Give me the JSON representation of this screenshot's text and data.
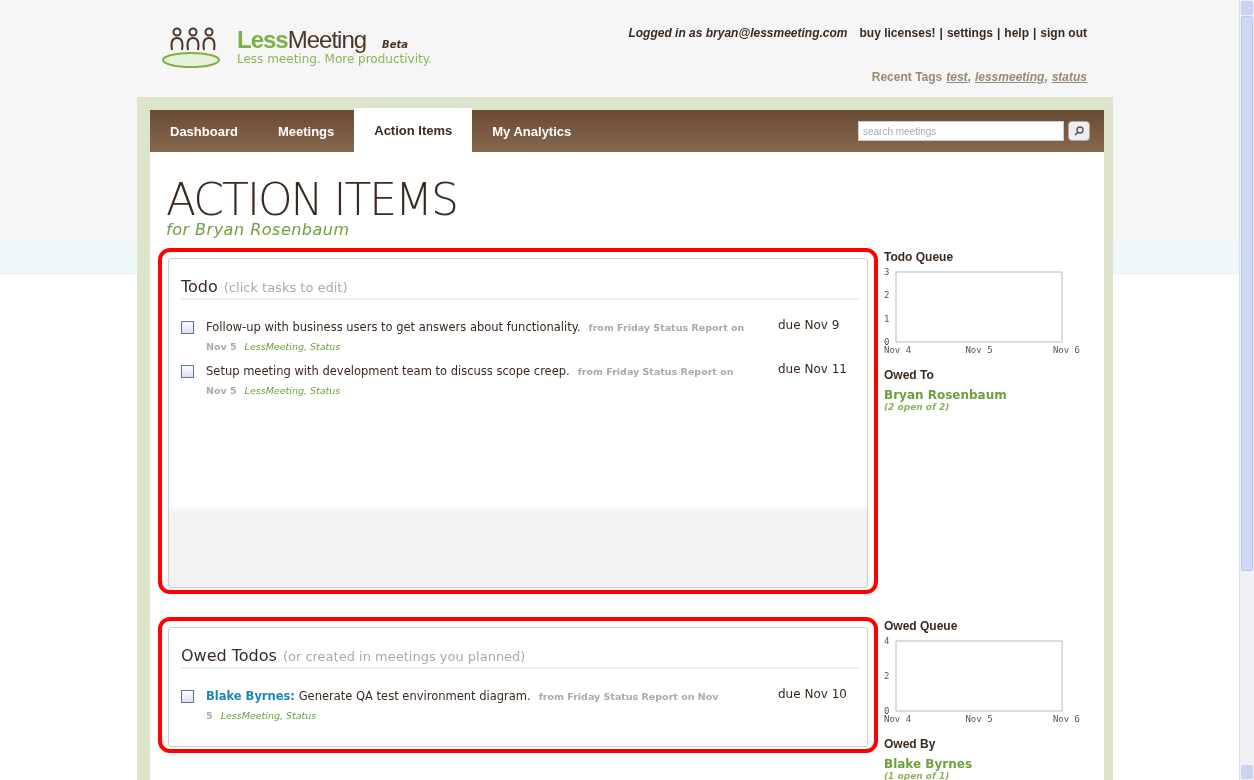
{
  "logo": {
    "name_a": "Less",
    "name_b": "Meeting",
    "badge": "Beta",
    "tagline": "Less meeting. More productivity."
  },
  "account": {
    "logged_in": "Logged in as bryan@lessmeeting.com",
    "separator": "|",
    "links": [
      "buy licenses!",
      "settings",
      "help",
      "sign out"
    ]
  },
  "recent_tags": {
    "label": "Recent Tags",
    "separator": ",",
    "tags": [
      "test",
      "lessmeeting",
      "status"
    ]
  },
  "tabs": [
    {
      "label": "Dashboard",
      "selected": false
    },
    {
      "label": "Meetings",
      "selected": false
    },
    {
      "label": "Action Items",
      "selected": true
    },
    {
      "label": "My Analytics",
      "selected": false
    }
  ],
  "search": {
    "placeholder": "search meetings"
  },
  "page": {
    "title": "ACTION ITEMS",
    "subtitle": "for Bryan Rosenbaum"
  },
  "sections": [
    {
      "title": "Todo",
      "hint": "(click tasks to edit)",
      "highlighted": true,
      "kind": "todo",
      "items": [
        {
          "text": "Follow-up with business users to get answers about functionality.",
          "source": "from Friday Status Report on Nov 5",
          "tags": "LessMeeting, Status",
          "due": "due Nov 9",
          "checked": false
        },
        {
          "text": "Setup meeting with development team to discuss scope creep.",
          "source": "from Friday Status Report on Nov 5",
          "tags": "LessMeeting, Status",
          "due": "due Nov 11",
          "checked": false
        }
      ],
      "side": {
        "chart_title": "Todo Queue",
        "chart_data": {
          "type": "line",
          "categories": [
            "Nov 4",
            "Nov 5",
            "Nov 6"
          ],
          "ylim": [
            0,
            3
          ],
          "yticks": [
            0,
            1,
            2,
            3
          ]
        },
        "people_title": "Owed To",
        "people": [
          {
            "name": "Bryan Rosenbaum",
            "count": "(2 open of 2)"
          }
        ]
      }
    },
    {
      "title": "Owed Todos",
      "hint": "(or created in meetings you planned)",
      "highlighted": true,
      "kind": "owed",
      "items": [
        {
          "owner": "Blake Byrnes:",
          "text": "Generate QA test environment diagram.",
          "source": "from Friday Status Report on Nov 5",
          "tags": "LessMeeting, Status",
          "due": "due Nov 10",
          "checked": false
        }
      ],
      "side": {
        "chart_title": "Owed Queue",
        "chart_data": {
          "type": "line",
          "categories": [
            "Nov 4",
            "Nov 5",
            "Nov 6"
          ],
          "ylim": [
            0,
            4
          ],
          "yticks": [
            0,
            2,
            4
          ]
        },
        "people_title": "Owed By",
        "people": [
          {
            "name": "Blake Byrnes",
            "count": "(1 open of 1)"
          }
        ]
      }
    }
  ]
}
